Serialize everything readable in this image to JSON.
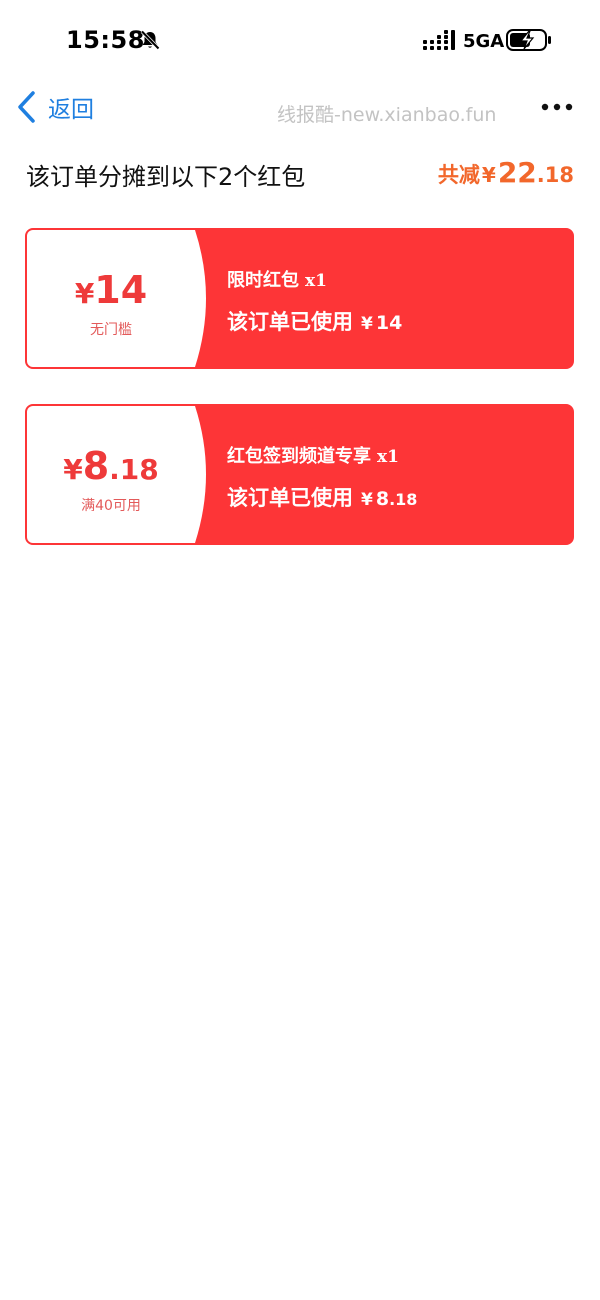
{
  "status_bar": {
    "time": "15:58",
    "network": "5GA",
    "icons": [
      "bell-muted-icon",
      "signal-icon",
      "battery-charging-icon"
    ]
  },
  "nav": {
    "back_label": "返回",
    "watermark": "线报酷-new.xianbao.fun",
    "icons": [
      "chevron-left-icon",
      "more-icon"
    ]
  },
  "header": {
    "title": "该订单分摊到以下2个红包",
    "total_prefix": "共减",
    "total_currency": "¥",
    "total_integer": "22",
    "total_decimal": ".18"
  },
  "coupons": [
    {
      "currency": "¥",
      "amount_integer": "14",
      "amount_decimal": "",
      "condition": "无门槛",
      "name": "限时红包",
      "quantity": "x1",
      "used_label": "该订单已使用",
      "used_currency": "¥",
      "used_integer": "14",
      "used_decimal": ""
    },
    {
      "currency": "¥",
      "amount_integer": "8",
      "amount_decimal": ".18",
      "condition": "满40可用",
      "name": "红包签到频道专享",
      "quantity": "x1",
      "used_label": "该订单已使用",
      "used_currency": "¥",
      "used_integer": "8",
      "used_decimal": ".18"
    }
  ],
  "colors": {
    "accent_blue": "#1f7fe0",
    "saving_orange": "#f2672b",
    "coupon_red": "#fd3537",
    "amount_red": "#ee3a3a"
  }
}
